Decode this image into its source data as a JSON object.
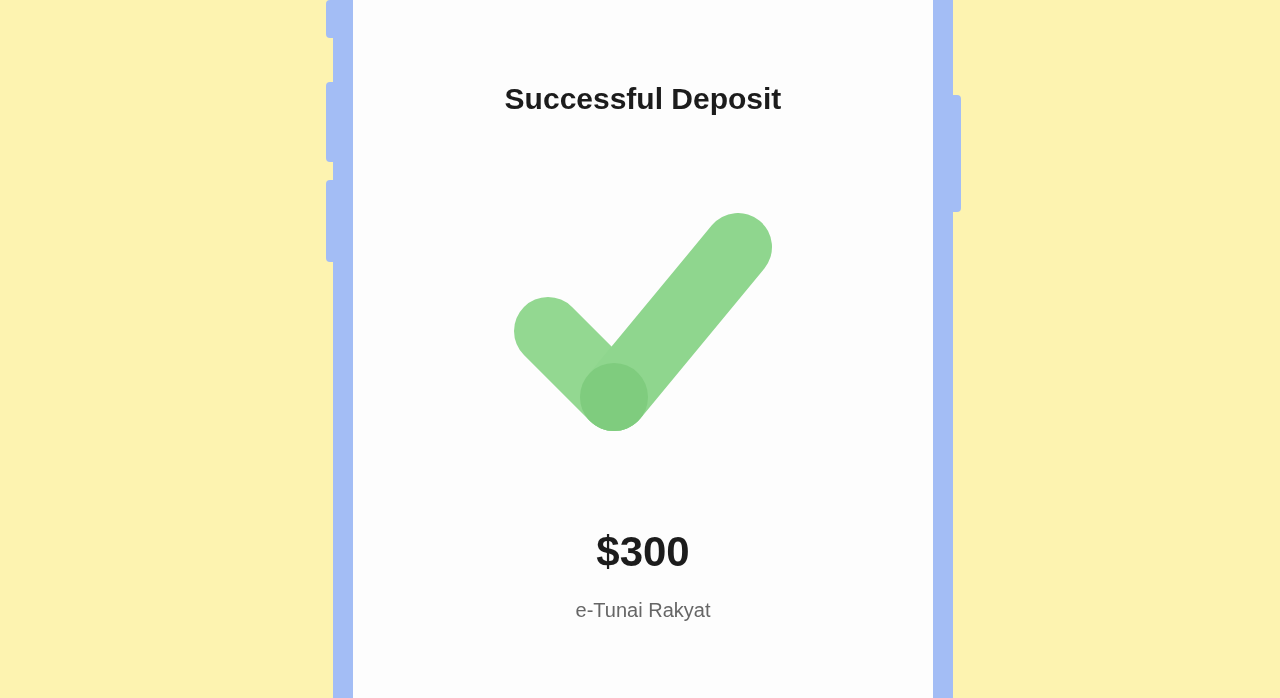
{
  "screen": {
    "title": "Successful Deposit",
    "amount": "$300",
    "wallet": "e-Tunai Rakyat"
  }
}
